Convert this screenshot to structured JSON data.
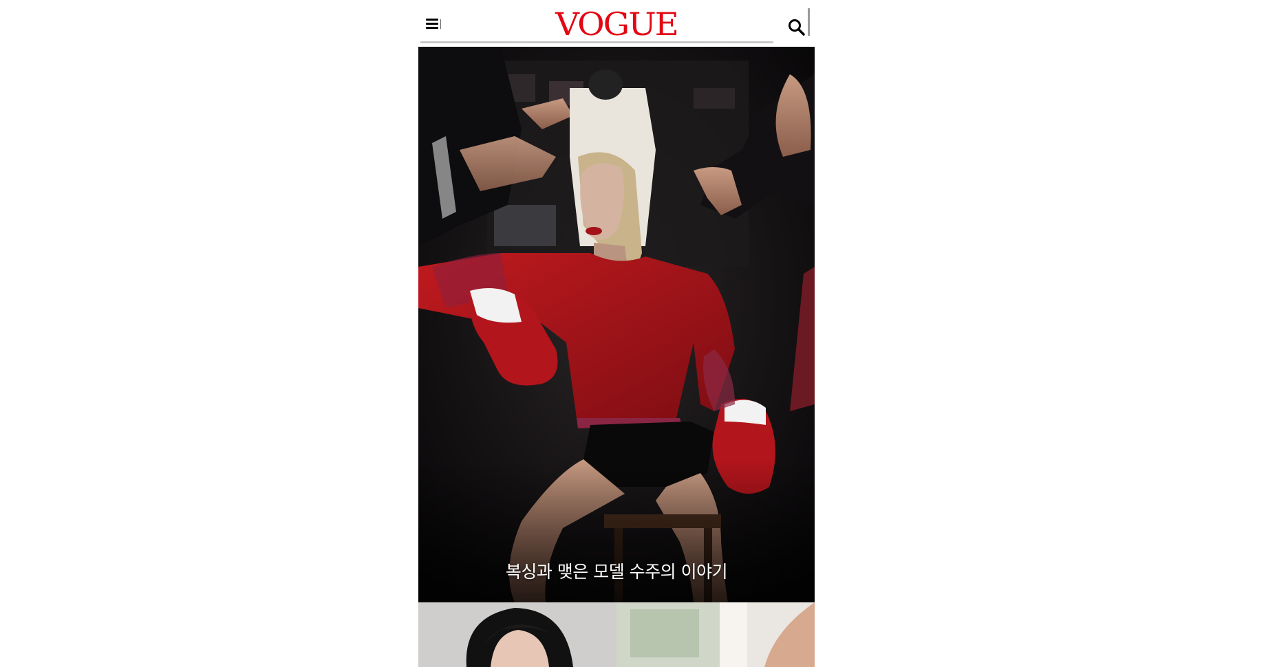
{
  "header": {
    "logo_text": "VOGUE",
    "menu_icon": "hamburger-menu-icon",
    "search_icon": "search-icon",
    "brand_color": "#e30613"
  },
  "hero": {
    "caption": "복싱과 맺은 모델 수주의 이야기"
  },
  "related": {
    "items": [
      {
        "image": "woman-portrait"
      },
      {
        "image": "bright-window-arm"
      }
    ]
  }
}
